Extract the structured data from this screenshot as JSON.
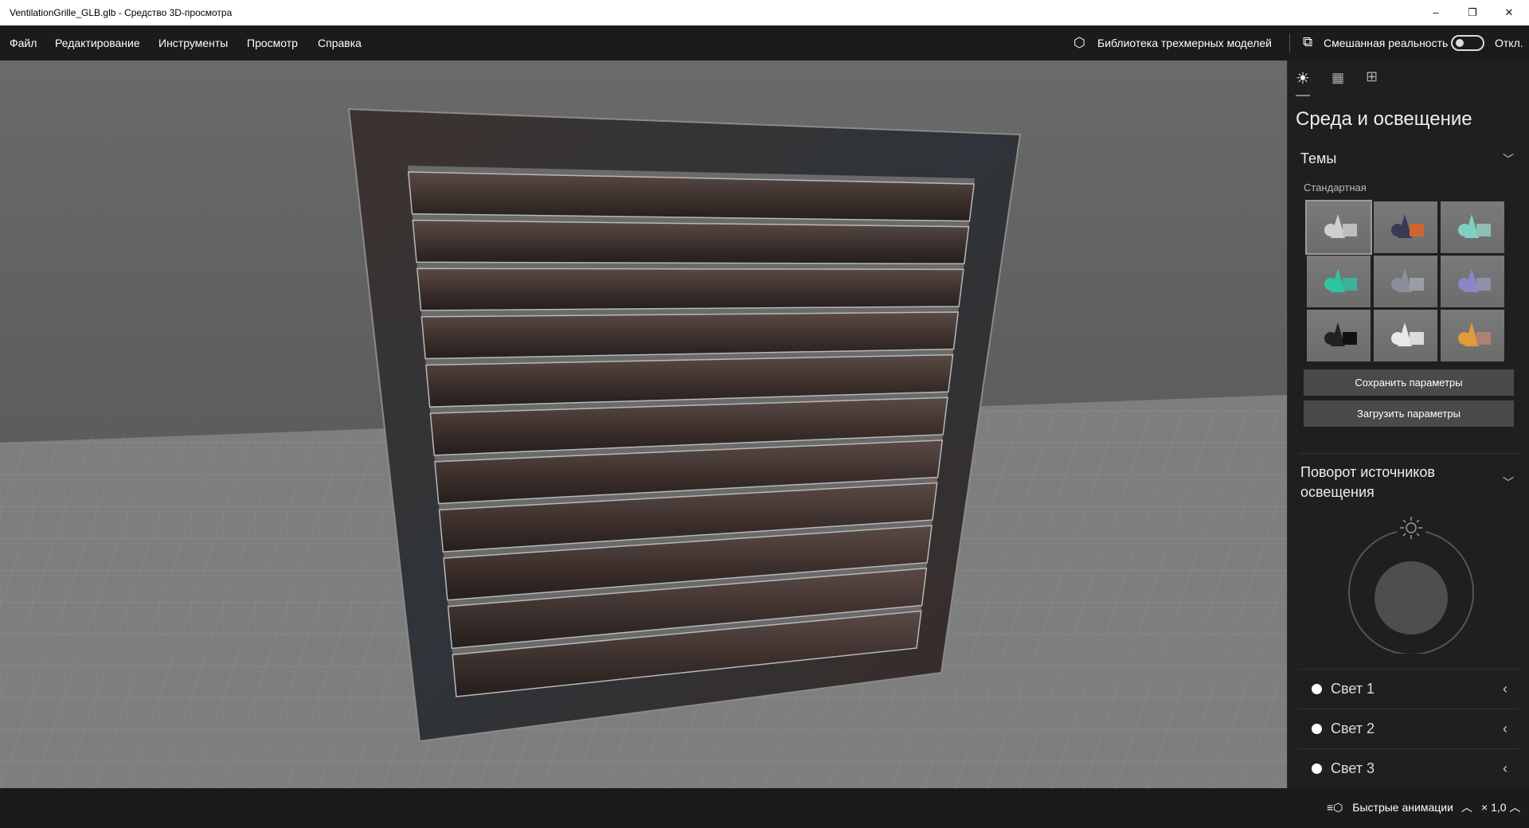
{
  "window": {
    "title": "VentilationGrille_GLB.glb - Средство 3D-просмотра",
    "minimize": "–",
    "maximize": "❐",
    "close": "✕"
  },
  "menu": [
    "Файл",
    "Редактирование",
    "Инструменты",
    "Просмотр",
    "Справка"
  ],
  "toolbar": {
    "library": "Библиотека трехмерных моделей",
    "mixed_reality": "Смешанная реальность",
    "toggle_state": "Откл.",
    "toggle_on": false
  },
  "panel": {
    "tabs": [
      "environment-lighting",
      "stats",
      "grid"
    ],
    "title": "Среда и освещение",
    "themes": {
      "header": "Темы",
      "group": "Стандартная",
      "items": [
        {
          "name": "neutral",
          "a": "#cfcfcf",
          "b": "#bdbdbd"
        },
        {
          "name": "orange",
          "a": "#3a3a55",
          "b": "#d0642e"
        },
        {
          "name": "teal",
          "a": "#7fd0c0",
          "b": "#8fbfb3"
        },
        {
          "name": "green",
          "a": "#2fc4a0",
          "b": "#3bb39a"
        },
        {
          "name": "gray",
          "a": "#8a9099",
          "b": "#9a9ea5"
        },
        {
          "name": "lilac",
          "a": "#8a86c8",
          "b": "#9090a8"
        },
        {
          "name": "black",
          "a": "#222",
          "b": "#111"
        },
        {
          "name": "white",
          "a": "#e8e8e8",
          "b": "#dcdcdc"
        },
        {
          "name": "purple-orange",
          "a": "#e39a3a",
          "b": "#b08070"
        }
      ],
      "selected": 0
    },
    "save": "Сохранить параметры",
    "load": "Загрузить параметры",
    "rotation": {
      "header": "Поворот источников освещения"
    },
    "lights": [
      "Свет 1",
      "Свет 2",
      "Свет 3"
    ]
  },
  "bottom": {
    "quick_anim": "Быстрые анимации",
    "speed": "× 1,0"
  }
}
